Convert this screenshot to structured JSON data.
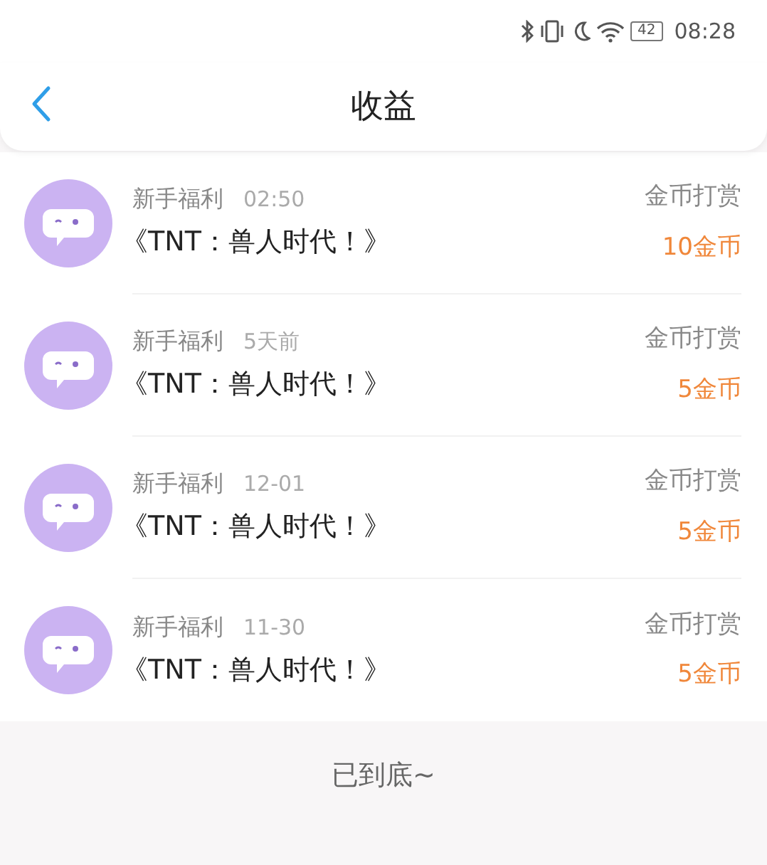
{
  "status_bar": {
    "battery": "42",
    "time": "08:28"
  },
  "header": {
    "title": "收益"
  },
  "items": [
    {
      "source": "新手福利",
      "time": "02:50",
      "book": "《TNT：兽人时代！》",
      "type": "金币打赏",
      "amount": "10金币"
    },
    {
      "source": "新手福利",
      "time": "5天前",
      "book": "《TNT：兽人时代！》",
      "type": "金币打赏",
      "amount": "5金币"
    },
    {
      "source": "新手福利",
      "time": "12-01",
      "book": "《TNT：兽人时代！》",
      "type": "金币打赏",
      "amount": "5金币"
    },
    {
      "source": "新手福利",
      "time": "11-30",
      "book": "《TNT：兽人时代！》",
      "type": "金币打赏",
      "amount": "5金币"
    }
  ],
  "footer": "已到底~"
}
